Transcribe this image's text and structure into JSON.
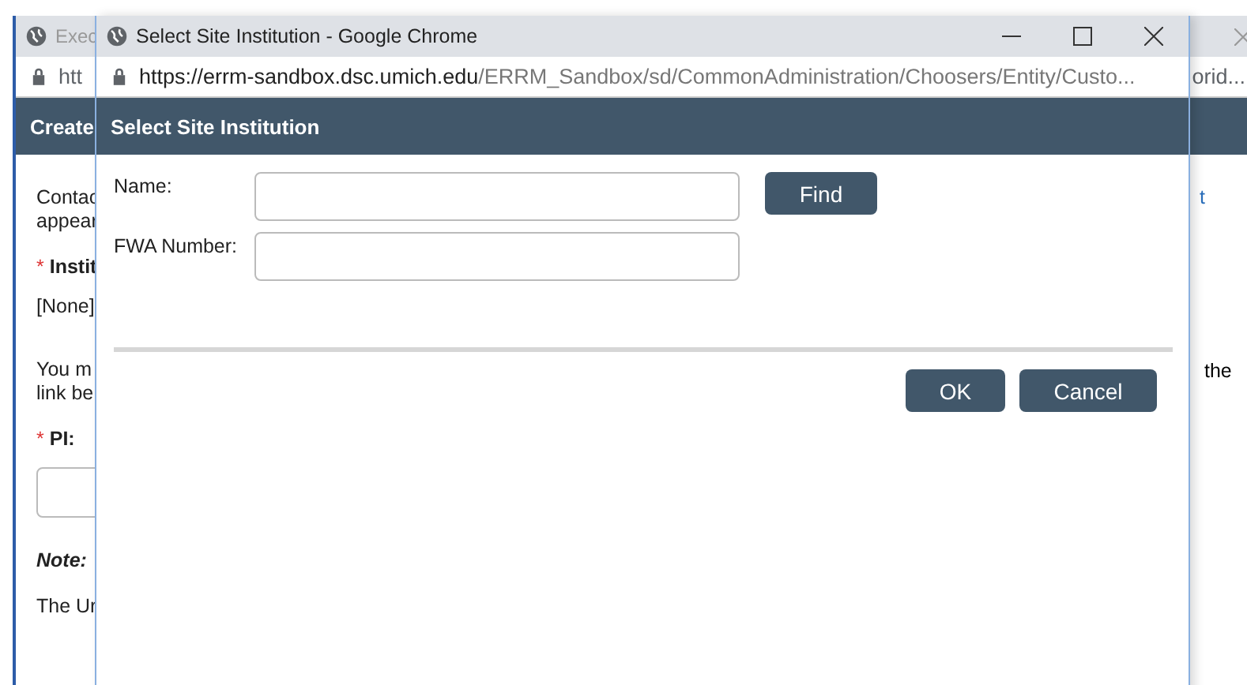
{
  "background_window": {
    "tab_title": "Exec",
    "url": "htt",
    "url_tail": "orid...",
    "header": "Create",
    "left_items": [
      {
        "kind": "text",
        "text": "Contac"
      },
      {
        "kind": "text",
        "text": "appear"
      },
      {
        "kind": "required",
        "marker": "*",
        "text": "Instit"
      },
      {
        "kind": "text",
        "text": "[None]"
      },
      {
        "kind": "text",
        "text": "You m"
      },
      {
        "kind": "text",
        "text": "link be"
      },
      {
        "kind": "required",
        "marker": "*",
        "text": "PI:"
      },
      {
        "kind": "field"
      },
      {
        "kind": "note",
        "text": "Note:"
      },
      {
        "kind": "text",
        "text": "The Ur"
      }
    ],
    "right_items": [
      {
        "kind": "link",
        "text": "t"
      },
      {
        "kind": "text",
        "text": "the"
      }
    ]
  },
  "popup": {
    "title": "Select Site Institution - Google Chrome",
    "url_host": "https://errm-sandbox.dsc.umich.edu",
    "url_path": "/ERRM_Sandbox/sd/CommonAdministration/Choosers/Entity/Custo...",
    "header": "Select Site Institution",
    "fields": [
      {
        "label": "Name:",
        "button": "Find"
      },
      {
        "label": "FWA Number:"
      }
    ],
    "buttons": [
      "OK",
      "Cancel"
    ]
  }
}
